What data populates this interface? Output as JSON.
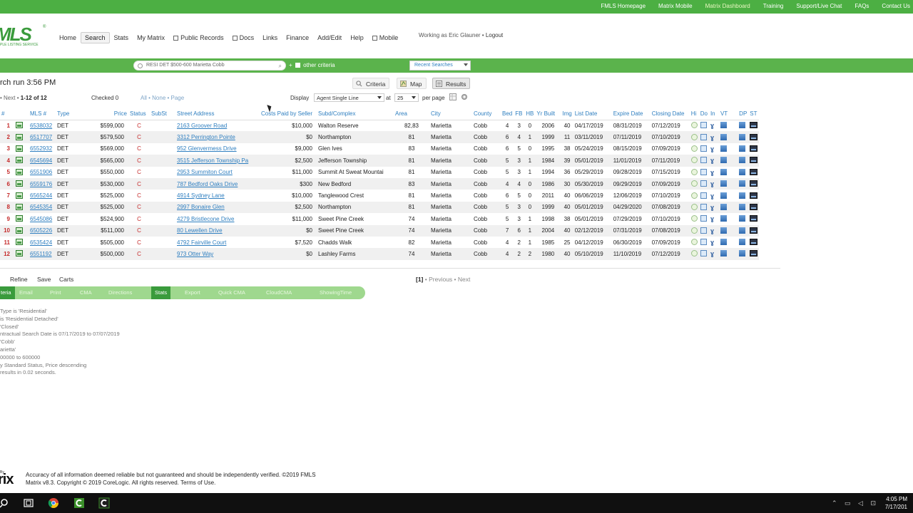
{
  "topbar": {
    "links": [
      "FMLS Homepage",
      "Matrix Mobile",
      "Matrix Dashboard",
      "Training",
      "Support/Live Chat",
      "FAQs",
      "Contact Us"
    ]
  },
  "logo": {
    "big": "MLS",
    "small": "PLE LISTING SERVICE",
    "reg": "®"
  },
  "nav": {
    "items": [
      "Home",
      "Search",
      "Stats",
      "My Matrix",
      "Public Records",
      "Docs",
      "Links",
      "Finance",
      "Add/Edit",
      "Help",
      "Mobile"
    ],
    "working_as": "Working as Eric Glauner",
    "logout": "Logout"
  },
  "searchbar": {
    "query": "RESI DET $500-600 Marietta Cobb",
    "other_criteria": "other criteria",
    "plus": "+",
    "recent": "Recent Searches"
  },
  "results": {
    "runtime": "rch run 3:56 PM",
    "views": {
      "criteria": "Criteria",
      "map": "Map",
      "results": "Results"
    },
    "pager_prefix": "• Next •",
    "pager_range": "1-12 of 12",
    "checked": "Checked 0",
    "select_links": "All • None • Page",
    "display_label": "Display",
    "display_value": "Agent Single Line",
    "at_label": "at",
    "per_page_value": "25",
    "per_page_label": "per page"
  },
  "table": {
    "headers": [
      "#",
      "",
      "MLS #",
      "Type",
      "",
      "Price",
      "Status",
      "SubSt",
      "Street Address",
      "Costs Paid by Seller",
      "Subd/Complex",
      "Area",
      "City",
      "County",
      "Bed",
      "FB",
      "HB",
      "Yr Built",
      "Img",
      "List Date",
      "Expire Date",
      "Closing Date",
      "Hi",
      "Do",
      "In",
      "VT",
      "",
      "DP",
      "ST"
    ],
    "rows": [
      {
        "n": "1",
        "mls": "6538032",
        "type": "DET",
        "price": "$599,000",
        "status": "C",
        "addr": "2163 Groover Road",
        "costs": "$10,000",
        "subd": "Walton Reserve",
        "area": "82,83",
        "city": "Marietta",
        "county": "Cobb",
        "bed": "4",
        "fb": "3",
        "hb": "0",
        "yr": "2006",
        "img": "40",
        "list": "04/17/2019",
        "exp": "08/31/2019",
        "close": "07/12/2019"
      },
      {
        "n": "2",
        "mls": "6517707",
        "type": "DET",
        "price": "$579,500",
        "status": "C",
        "addr": "3312 Perrington Pointe",
        "costs": "$0",
        "subd": "Northampton",
        "area": "81",
        "city": "Marietta",
        "county": "Cobb",
        "bed": "6",
        "fb": "4",
        "hb": "1",
        "yr": "1999",
        "img": "11",
        "list": "03/11/2019",
        "exp": "07/11/2019",
        "close": "07/10/2019"
      },
      {
        "n": "3",
        "mls": "6552932",
        "type": "DET",
        "price": "$569,000",
        "status": "C",
        "addr": "952 Glenvermess Drive",
        "costs": "$9,000",
        "subd": "Glen Ives",
        "area": "83",
        "city": "Marietta",
        "county": "Cobb",
        "bed": "6",
        "fb": "5",
        "hb": "0",
        "yr": "1995",
        "img": "38",
        "list": "05/24/2019",
        "exp": "08/15/2019",
        "close": "07/09/2019"
      },
      {
        "n": "4",
        "mls": "6545694",
        "type": "DET",
        "price": "$565,000",
        "status": "C",
        "addr": "3515 Jefferson Township Pa",
        "costs": "$2,500",
        "subd": "Jefferson Township",
        "area": "81",
        "city": "Marietta",
        "county": "Cobb",
        "bed": "5",
        "fb": "3",
        "hb": "1",
        "yr": "1984",
        "img": "39",
        "list": "05/01/2019",
        "exp": "11/01/2019",
        "close": "07/11/2019"
      },
      {
        "n": "5",
        "mls": "6551906",
        "type": "DET",
        "price": "$550,000",
        "status": "C",
        "addr": "2953 Summiton Court",
        "costs": "$11,000",
        "subd": "Summit At Sweat Mountai",
        "area": "81",
        "city": "Marietta",
        "county": "Cobb",
        "bed": "5",
        "fb": "3",
        "hb": "1",
        "yr": "1994",
        "img": "36",
        "list": "05/29/2019",
        "exp": "09/28/2019",
        "close": "07/15/2019"
      },
      {
        "n": "6",
        "mls": "6559176",
        "type": "DET",
        "price": "$530,000",
        "status": "C",
        "addr": "787 Bedford Oaks Drive",
        "costs": "$300",
        "subd": "New Bedford",
        "area": "83",
        "city": "Marietta",
        "county": "Cobb",
        "bed": "4",
        "fb": "4",
        "hb": "0",
        "yr": "1986",
        "img": "30",
        "list": "05/30/2019",
        "exp": "09/29/2019",
        "close": "07/09/2019"
      },
      {
        "n": "7",
        "mls": "6565244",
        "type": "DET",
        "price": "$525,000",
        "status": "C",
        "addr": "4914 Sydney Lane",
        "costs": "$10,000",
        "subd": "Tanglewood Crest",
        "area": "81",
        "city": "Marietta",
        "county": "Cobb",
        "bed": "6",
        "fb": "5",
        "hb": "0",
        "yr": "2011",
        "img": "40",
        "list": "06/06/2019",
        "exp": "12/06/2019",
        "close": "07/10/2019"
      },
      {
        "n": "8",
        "mls": "6545354",
        "type": "DET",
        "price": "$525,000",
        "status": "C",
        "addr": "2997 Bonaire Glen",
        "costs": "$2,500",
        "subd": "Northampton",
        "area": "81",
        "city": "Marietta",
        "county": "Cobb",
        "bed": "5",
        "fb": "3",
        "hb": "0",
        "yr": "1999",
        "img": "40",
        "list": "05/01/2019",
        "exp": "04/29/2020",
        "close": "07/08/2019"
      },
      {
        "n": "9",
        "mls": "6545086",
        "type": "DET",
        "price": "$524,900",
        "status": "C",
        "addr": "4279 Bristlecone Drive",
        "costs": "$11,000",
        "subd": "Sweet Pine Creek",
        "area": "74",
        "city": "Marietta",
        "county": "Cobb",
        "bed": "5",
        "fb": "3",
        "hb": "1",
        "yr": "1998",
        "img": "38",
        "list": "05/01/2019",
        "exp": "07/29/2019",
        "close": "07/10/2019"
      },
      {
        "n": "10",
        "mls": "6505226",
        "type": "DET",
        "price": "$511,000",
        "status": "C",
        "addr": "80 Lewellen Drive",
        "costs": "$0",
        "subd": "Sweet Pine Creek",
        "area": "74",
        "city": "Marietta",
        "county": "Cobb",
        "bed": "7",
        "fb": "6",
        "hb": "1",
        "yr": "2004",
        "img": "40",
        "list": "02/12/2019",
        "exp": "07/31/2019",
        "close": "07/08/2019"
      },
      {
        "n": "11",
        "mls": "6535424",
        "type": "DET",
        "price": "$505,000",
        "status": "C",
        "addr": "4792 Fairville Court",
        "costs": "$7,520",
        "subd": "Chadds Walk",
        "area": "82",
        "city": "Marietta",
        "county": "Cobb",
        "bed": "4",
        "fb": "2",
        "hb": "1",
        "yr": "1985",
        "img": "25",
        "list": "04/12/2019",
        "exp": "06/30/2019",
        "close": "07/09/2019"
      },
      {
        "n": "12",
        "mls": "6551192",
        "type": "DET",
        "price": "$500,000",
        "status": "C",
        "addr": "973 Otter Way",
        "costs": "$0",
        "subd": "Lashley Farms",
        "area": "74",
        "city": "Marietta",
        "county": "Cobb",
        "bed": "4",
        "fb": "2",
        "hb": "2",
        "yr": "1980",
        "img": "40",
        "list": "05/10/2019",
        "exp": "11/10/2019",
        "close": "07/12/2019"
      }
    ]
  },
  "actions": {
    "refine": "Refine",
    "save": "Save",
    "carts": "Carts",
    "pager_current": "[1]",
    "pager_rest": "• Previous • Next",
    "greenbar": [
      "teria",
      "Email",
      "Print",
      "CMA",
      "Directions",
      "Stats",
      "Export",
      "Quick CMA",
      "CloudCMA",
      "ShowingTime"
    ]
  },
  "criteria_lines": [
    "Type is 'Residential'",
    "is 'Residential Detached'",
    "'Closed'",
    "ntractual Search Date is 07/17/2019 to 07/07/2019",
    "'Cobb'",
    "arietta'",
    "00000 to 600000",
    "y Standard Status, Price descending",
    "results in 0.02 seconds."
  ],
  "footer": {
    "by": "By",
    "matrix": "rix",
    "line1": "Accuracy of all information deemed reliable but not guaranteed and should be independently verified. ©2019 FMLS",
    "line2": "Matrix v8.3. Copyright © 2019 CoreLogic. All rights reserved. Terms of Use."
  },
  "taskbar": {
    "time": "4:05 PM",
    "date": "7/17/201"
  },
  "colors": {
    "brand_green": "#4caf43",
    "link_blue": "#2f7fc0",
    "status_red": "#c52a2a"
  }
}
